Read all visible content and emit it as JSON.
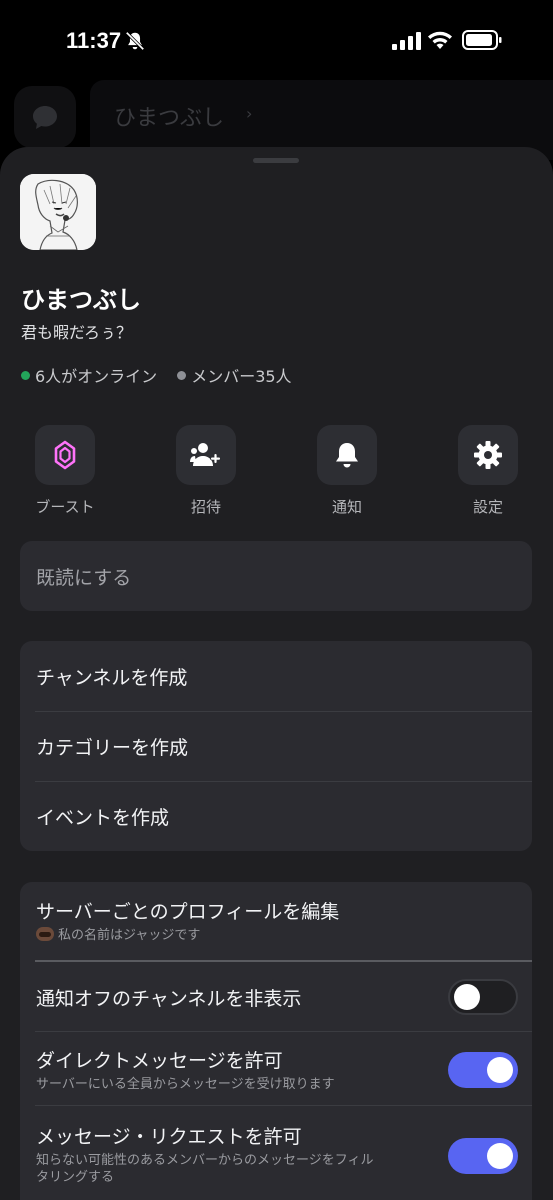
{
  "status_bar": {
    "time": "11:37"
  },
  "background": {
    "server_title": "ひまつぶし",
    "chevron": "›"
  },
  "server": {
    "name": "ひまつぶし",
    "description": "君も暇だろぅ？",
    "online": "6人がオンライン",
    "members": "メンバー35人"
  },
  "actions": [
    {
      "label": "ブースト",
      "icon": "boost-icon"
    },
    {
      "label": "招待",
      "icon": "invite-user-icon"
    },
    {
      "label": "通知",
      "icon": "bell-icon"
    },
    {
      "label": "設定",
      "icon": "gear-icon"
    }
  ],
  "mark_read": "既読にする",
  "create_menu": [
    "チャンネルを作成",
    "カテゴリーを作成",
    "イベントを作成"
  ],
  "settings": {
    "profile": {
      "title": "サーバーごとのプロフィールを編集",
      "subtitle": "私の名前はジャッジです"
    },
    "hide_muted": {
      "title": "通知オフのチャンネルを非表示",
      "enabled": false
    },
    "allow_dm": {
      "title": "ダイレクトメッセージを許可",
      "subtitle": "サーバーにいる全員からメッセージを受け取ります",
      "enabled": true
    },
    "allow_requests": {
      "title": "メッセージ・リクエストを許可",
      "subtitle_line1": "知らない可能性のあるメンバーからのメッセージをフィル",
      "subtitle_line2": "タリングする",
      "enabled": true
    }
  },
  "colors": {
    "accent": "#5865f2",
    "online": "#23a55a",
    "boost": "#ff73fa"
  }
}
